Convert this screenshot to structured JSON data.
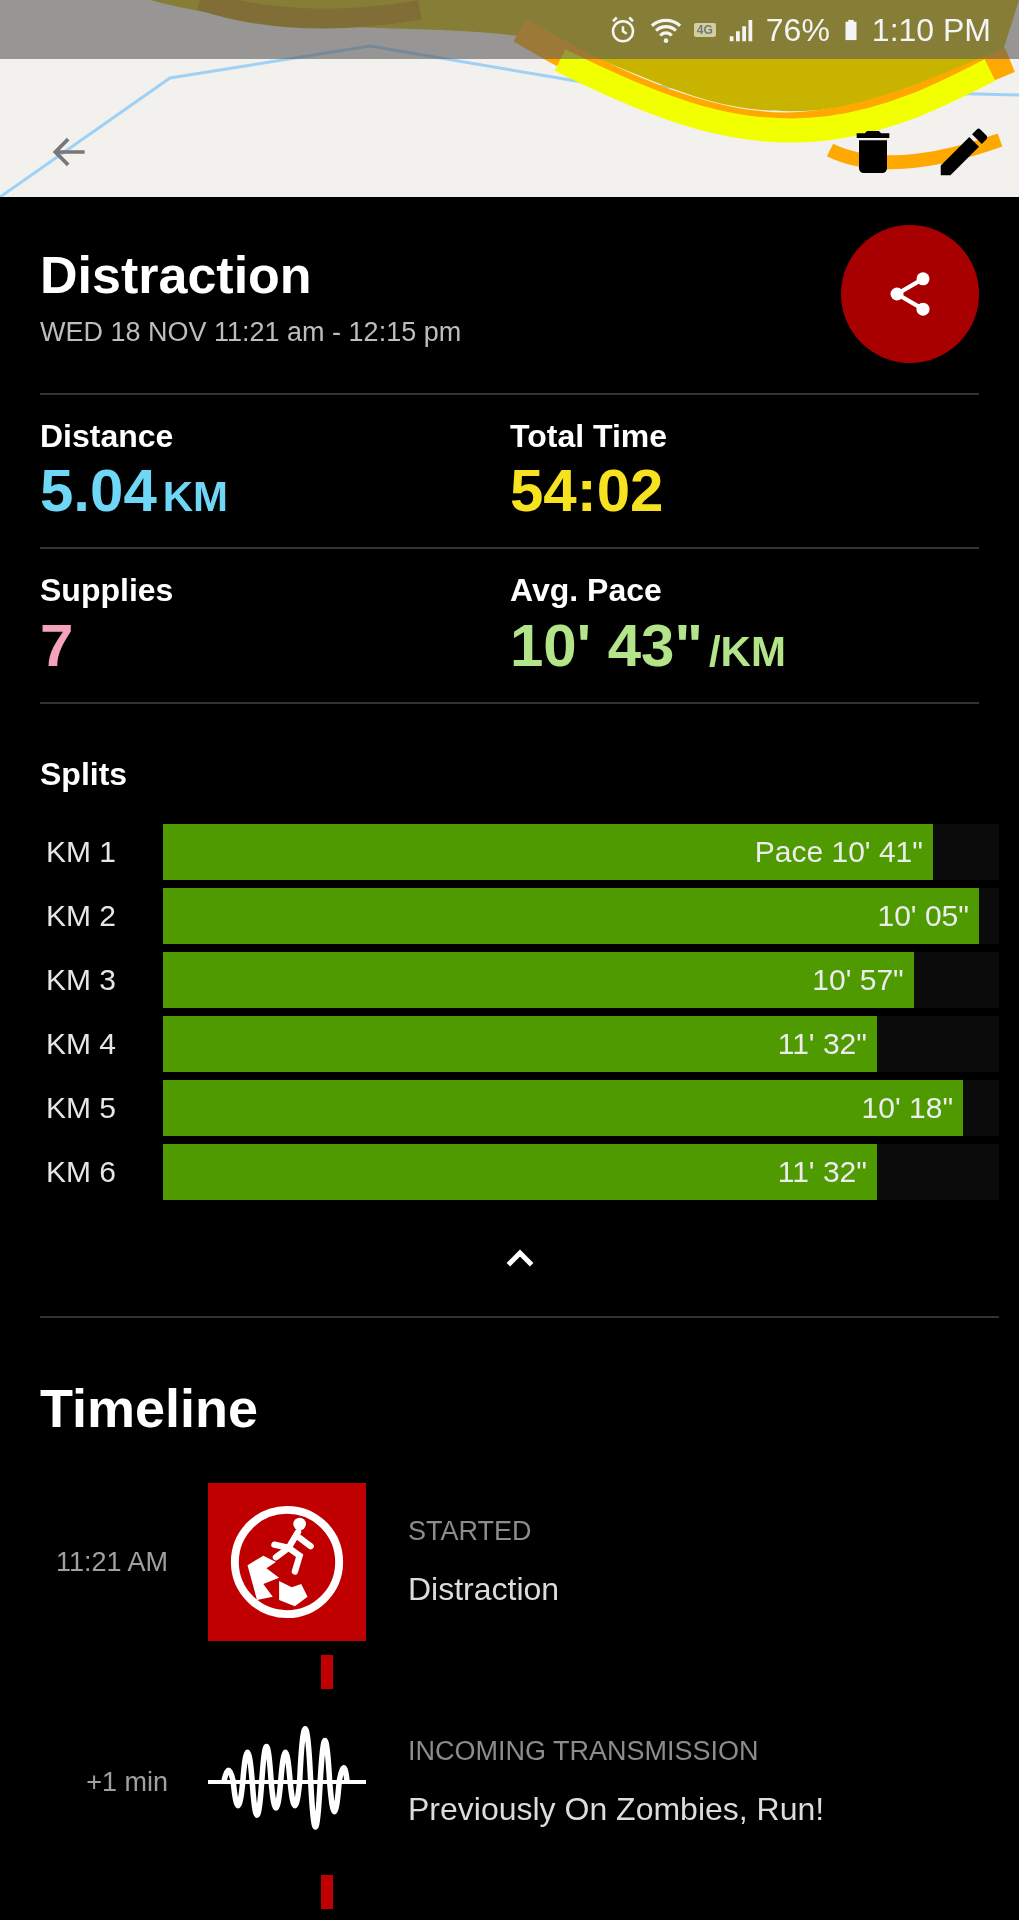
{
  "status_bar": {
    "network": "4G",
    "battery": "76%",
    "time": "1:10 PM"
  },
  "header": {
    "title": "Distraction",
    "subtitle": "WED 18 NOV 11:21 am - 12:15 pm"
  },
  "stats": [
    {
      "label": "Distance",
      "value": "5.04",
      "unit": "KM",
      "color": "#6fd6f6"
    },
    {
      "label": "Total Time",
      "value": "54:02",
      "color": "#f6e21e"
    },
    {
      "label": "Supplies",
      "value": "7",
      "color": "#f4a3bb"
    },
    {
      "label": "Avg. Pace",
      "value": "10' 43\"",
      "unit": "/KM",
      "color": "#b4e48a"
    }
  ],
  "splits": {
    "title": "Splits",
    "expanded": true,
    "rows": [
      {
        "label": "KM 1",
        "value": "Pace 10' 41\"",
        "level": 0.921
      },
      {
        "label": "KM 2",
        "value": "10' 05\"",
        "level": 0.976
      },
      {
        "label": "KM 3",
        "value": "10' 57\"",
        "level": 0.898
      },
      {
        "label": "KM 4",
        "value": "11' 32\"",
        "level": 0.854
      },
      {
        "label": "KM 5",
        "value": "10' 18\"",
        "level": 0.957
      },
      {
        "label": "KM 6",
        "value": "11' 32\"",
        "level": 0.854
      }
    ]
  },
  "timeline": {
    "title": "Timeline",
    "events": [
      {
        "kind": "start",
        "time": "11:21 AM",
        "category": "STARTED",
        "title": "Distraction"
      },
      {
        "kind": "transmission",
        "time": "+1 min",
        "category": "INCOMING TRANSMISSION",
        "title": "Previously On Zombies, Run!"
      }
    ]
  }
}
